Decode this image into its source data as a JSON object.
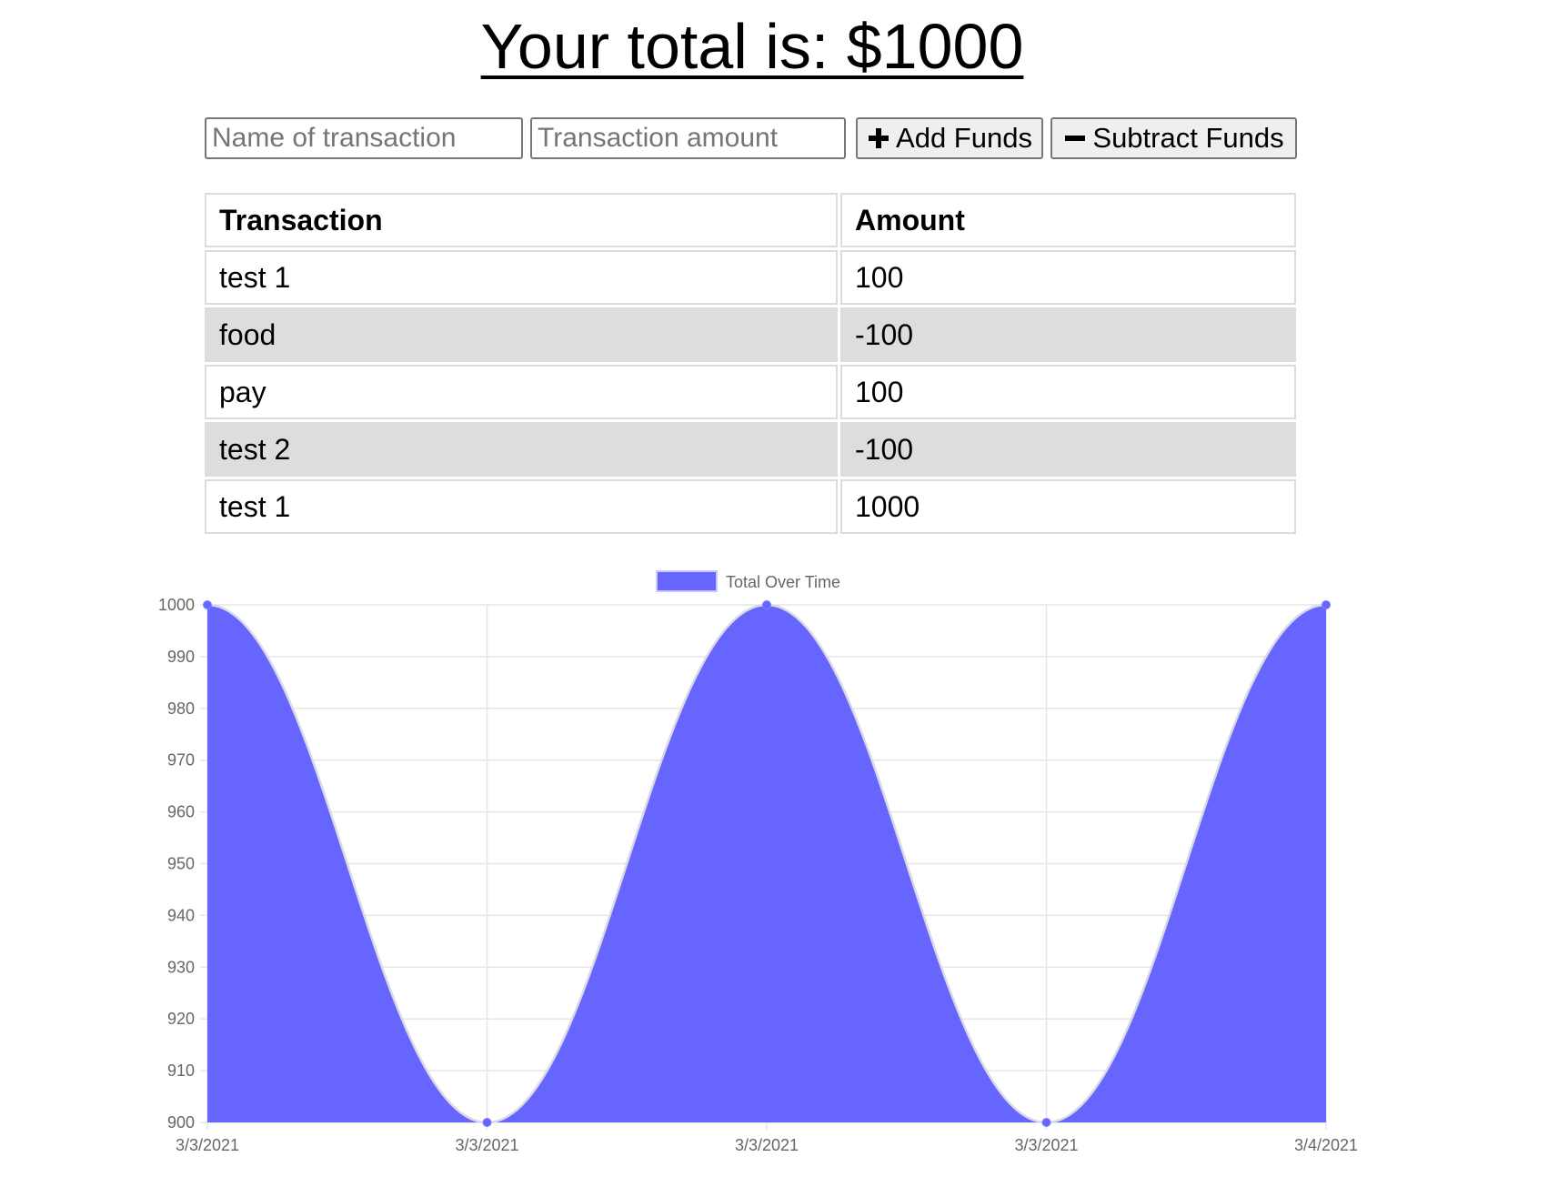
{
  "header": {
    "total_text": "Your total is: $1000"
  },
  "form": {
    "name_placeholder": "Name of transaction",
    "amount_placeholder": "Transaction amount",
    "add_label": "Add Funds",
    "subtract_label": "Subtract Funds",
    "add_icon": "plus-icon",
    "subtract_icon": "minus-icon"
  },
  "table": {
    "headers": [
      "Transaction",
      "Amount"
    ],
    "rows": [
      {
        "name": "test 1",
        "amount": "100"
      },
      {
        "name": "food",
        "amount": "-100"
      },
      {
        "name": "pay",
        "amount": "100"
      },
      {
        "name": "test 2",
        "amount": "-100"
      },
      {
        "name": "test 1",
        "amount": "1000"
      }
    ]
  },
  "chart_data": {
    "type": "area",
    "x": [
      "3/3/2021",
      "3/3/2021",
      "3/3/2021",
      "3/3/2021",
      "3/4/2021"
    ],
    "series": [
      {
        "name": "Total Over Time",
        "values": [
          1000,
          900,
          1000,
          900,
          1000
        ],
        "color": "#6666ff"
      }
    ],
    "yticks": [
      900,
      910,
      920,
      930,
      940,
      950,
      960,
      970,
      980,
      990,
      1000
    ],
    "ylim": [
      900,
      1000
    ],
    "grid": true,
    "legend": "top-center"
  }
}
